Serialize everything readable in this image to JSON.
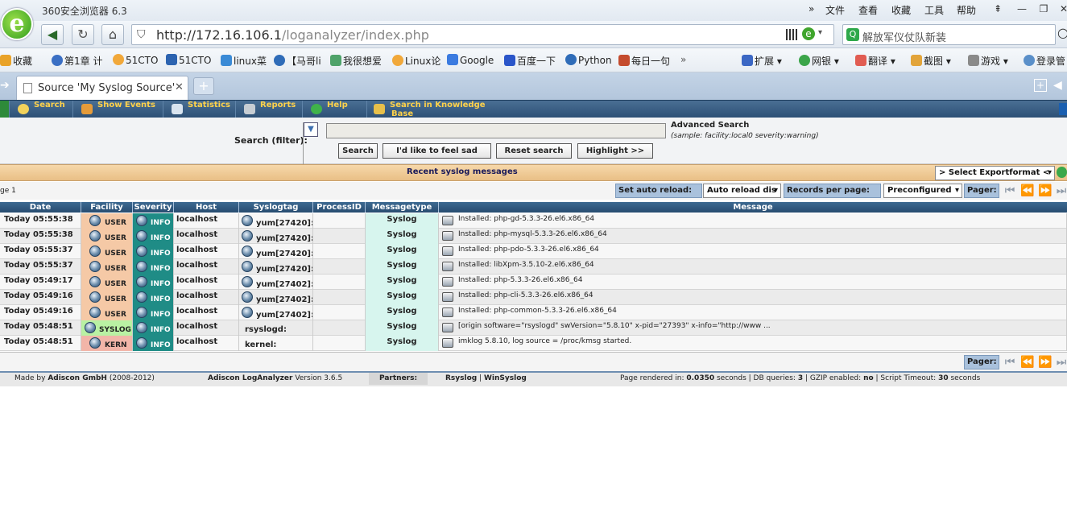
{
  "browser": {
    "title": "360安全浏览器 6.3",
    "menu": [
      "文件",
      "查看",
      "收藏",
      "工具",
      "帮助"
    ],
    "url_host": "http://172.16.106.1",
    "url_path": "/loganalyzer/index.php",
    "search_text": "解放军仪仗队新装",
    "bookmarks": [
      "收藏",
      "第1章 计",
      "51CTO",
      "51CTO",
      "linux菜",
      "【马哥li",
      "我很想爱",
      "Linux论",
      "Google",
      "百度一下",
      "Python",
      "每日一句"
    ],
    "extensions": [
      "扩展",
      "网银",
      "翻译",
      "截图",
      "游戏",
      "登录管"
    ],
    "tab_title": "Source 'My Syslog Source'",
    "colors": {
      "accent": "#2d5076",
      "menu_text": "#ffd24a",
      "severity_bg": "#1f8c86",
      "type_bg": "#d7f5ee",
      "user_bg": "#f5c9a6",
      "syslog_bg": "#b9f1a3",
      "kern_bg": "#f2b5a8"
    }
  },
  "app_menu": [
    "Search",
    "Show Events",
    "Statistics",
    "Reports",
    "Help",
    "Search in Knowledge Base"
  ],
  "search": {
    "label": "Search (filter):",
    "advanced": "Advanced Search",
    "sample": "(sample: facility:local0 severity:warning)",
    "buttons": [
      "Search",
      "I'd like to feel sad",
      "Reset search",
      "Highlight >>"
    ]
  },
  "recent": {
    "title": "Recent syslog messages",
    "export": "> Select Exportformat <"
  },
  "pager": {
    "page": "ge 1",
    "auto_reload_label": "Set auto reload:",
    "auto_reload_value": "Auto reload dis",
    "records_label": "Records per page:",
    "records_value": "Preconfigured",
    "pager_label": "Pager:"
  },
  "table": {
    "headers": [
      "Date",
      "Facility",
      "Severity",
      "Host",
      "Syslogtag",
      "ProcessID",
      "Messagetype",
      "Message"
    ],
    "rows": [
      {
        "date": "Today 05:55:38",
        "facility": "USER",
        "severity": "INFO",
        "host": "localhost",
        "tag": "yum[27420]:",
        "pid": "",
        "type": "Syslog",
        "msg": "Installed: php-gd-5.3.3-26.el6.x86_64"
      },
      {
        "date": "Today 05:55:38",
        "facility": "USER",
        "severity": "INFO",
        "host": "localhost",
        "tag": "yum[27420]:",
        "pid": "",
        "type": "Syslog",
        "msg": "Installed: php-mysql-5.3.3-26.el6.x86_64"
      },
      {
        "date": "Today 05:55:37",
        "facility": "USER",
        "severity": "INFO",
        "host": "localhost",
        "tag": "yum[27420]:",
        "pid": "",
        "type": "Syslog",
        "msg": "Installed: php-pdo-5.3.3-26.el6.x86_64"
      },
      {
        "date": "Today 05:55:37",
        "facility": "USER",
        "severity": "INFO",
        "host": "localhost",
        "tag": "yum[27420]:",
        "pid": "",
        "type": "Syslog",
        "msg": "Installed: libXpm-3.5.10-2.el6.x86_64"
      },
      {
        "date": "Today 05:49:17",
        "facility": "USER",
        "severity": "INFO",
        "host": "localhost",
        "tag": "yum[27402]:",
        "pid": "",
        "type": "Syslog",
        "msg": "Installed: php-5.3.3-26.el6.x86_64"
      },
      {
        "date": "Today 05:49:16",
        "facility": "USER",
        "severity": "INFO",
        "host": "localhost",
        "tag": "yum[27402]:",
        "pid": "",
        "type": "Syslog",
        "msg": "Installed: php-cli-5.3.3-26.el6.x86_64"
      },
      {
        "date": "Today 05:49:16",
        "facility": "USER",
        "severity": "INFO",
        "host": "localhost",
        "tag": "yum[27402]:",
        "pid": "",
        "type": "Syslog",
        "msg": "Installed: php-common-5.3.3-26.el6.x86_64"
      },
      {
        "date": "Today 05:48:51",
        "facility": "SYSLOG",
        "severity": "INFO",
        "host": "localhost",
        "tag": "rsyslogd:",
        "pid": "",
        "type": "Syslog",
        "msg": "[origin software=\"rsyslogd\" swVersion=\"5.8.10\" x-pid=\"27393\" x-info=\"http://www ..."
      },
      {
        "date": "Today 05:48:51",
        "facility": "KERN",
        "severity": "INFO",
        "host": "localhost",
        "tag": "kernel:",
        "pid": "",
        "type": "Syslog",
        "msg": "imklog 5.8.10, log source = /proc/kmsg started."
      }
    ]
  },
  "footer": {
    "made_by_pre": "Made by",
    "made_by_company": "Adiscon GmbH",
    "made_by_years": "(2008-2012)",
    "product": "Adiscon LogAnalyzer",
    "version": "Version 3.6.5",
    "partners_label": "Partners:",
    "partner1": "Rsyslog",
    "partner2": "WinSyslog",
    "rendered_label": "Page rendered in:",
    "rendered_value": "0.0350",
    "rendered_unit": "seconds",
    "db_label": "DB queries:",
    "db_value": "3",
    "gzip_label": "GZIP enabled:",
    "gzip_value": "no",
    "timeout_label": "Script Timeout:",
    "timeout_value": "30",
    "timeout_unit": "seconds"
  }
}
